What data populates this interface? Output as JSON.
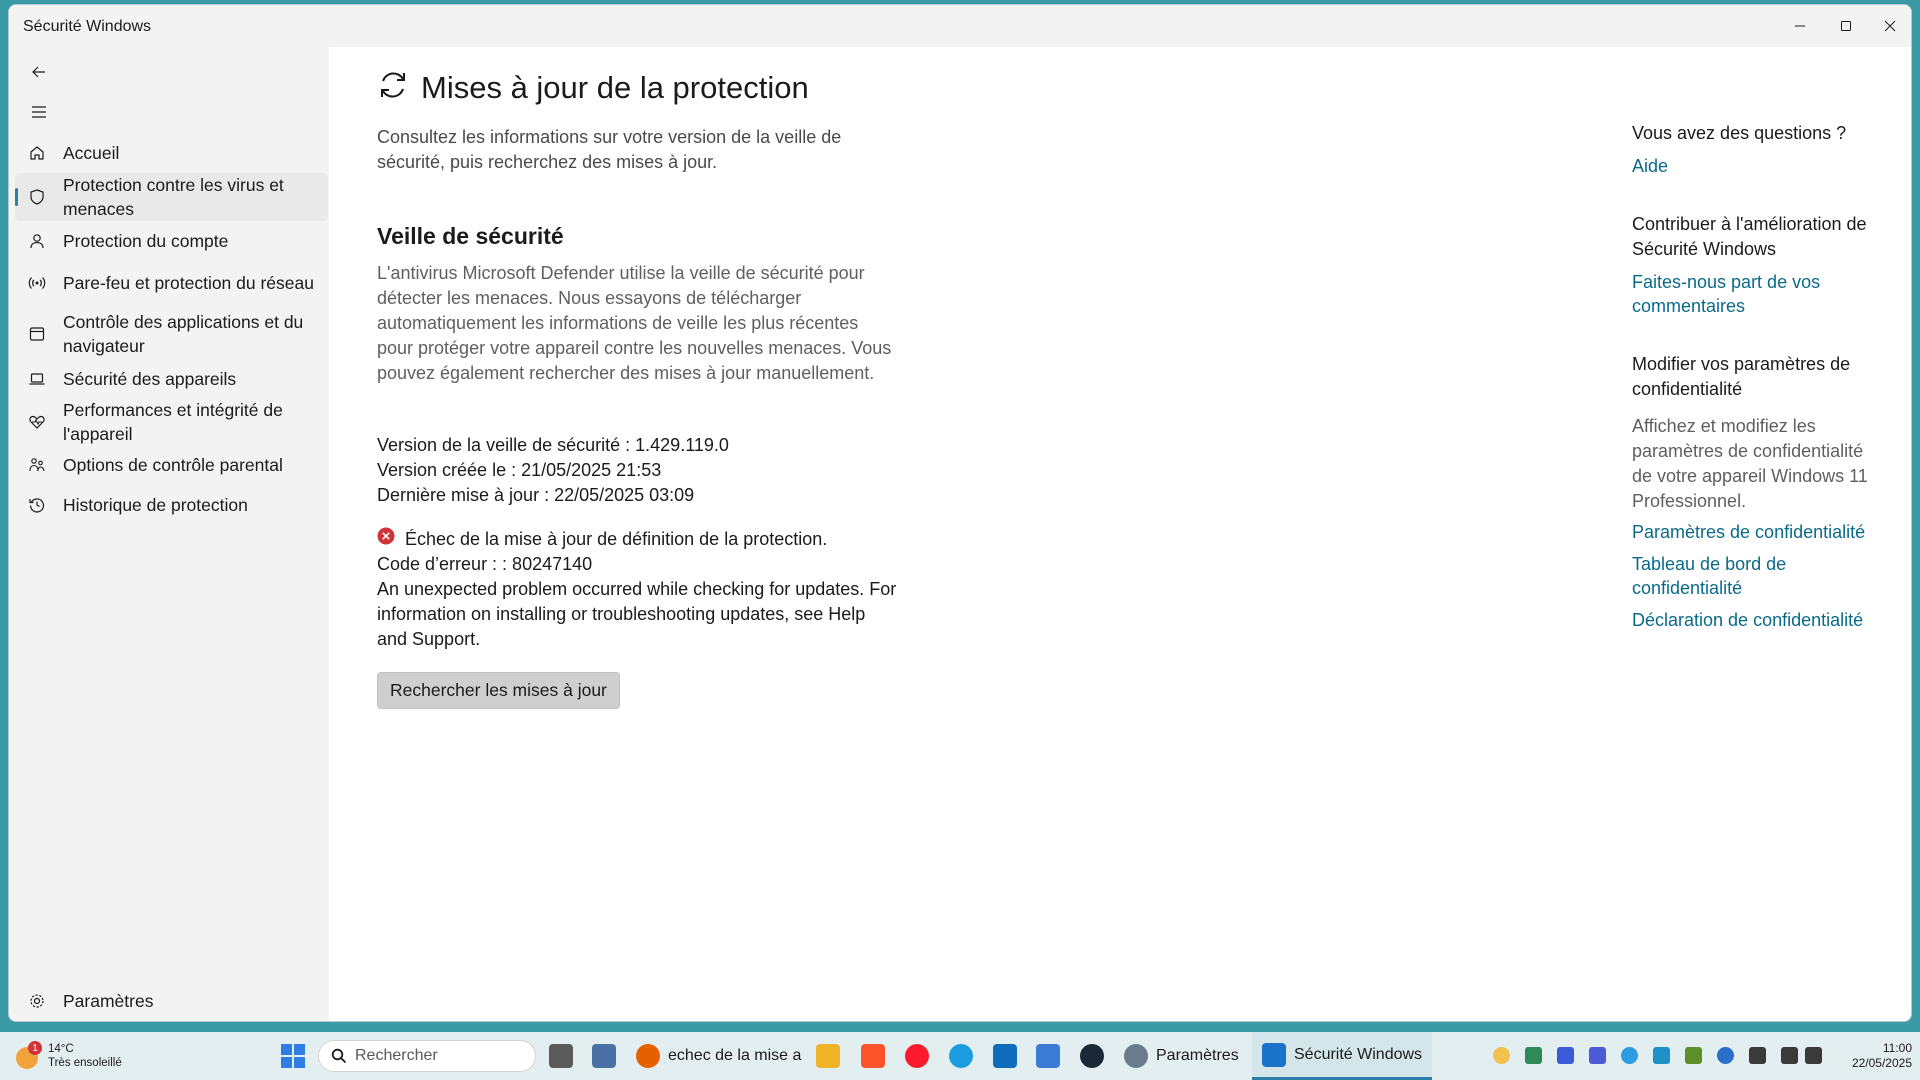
{
  "window": {
    "title": "Sécurité Windows",
    "controls": [
      "minimize",
      "maximize",
      "close"
    ]
  },
  "sidebar": {
    "back_icon": "back-arrow-icon",
    "menu_icon": "hamburger-menu-icon",
    "items": [
      {
        "label": "Accueil",
        "icon": "home-icon",
        "active": false
      },
      {
        "label": "Protection contre les virus et menaces",
        "icon": "shield-icon",
        "active": true
      },
      {
        "label": "Protection du compte",
        "icon": "person-icon",
        "active": false
      },
      {
        "label": "Pare-feu et protection du réseau",
        "icon": "antenna-icon",
        "active": false
      },
      {
        "label": "Contrôle des applications et du navigateur",
        "icon": "app-window-icon",
        "active": false
      },
      {
        "label": "Sécurité des appareils",
        "icon": "laptop-icon",
        "active": false
      },
      {
        "label": "Performances et intégrité de l'appareil",
        "icon": "heart-pulse-icon",
        "active": false
      },
      {
        "label": "Options de contrôle parental",
        "icon": "family-icon",
        "active": false
      },
      {
        "label": "Historique de protection",
        "icon": "history-icon",
        "active": false
      }
    ],
    "settings": {
      "label": "Paramètres",
      "icon": "gear-icon"
    }
  },
  "main": {
    "title": "Mises à jour de la protection",
    "title_icon": "refresh-icon",
    "description": "Consultez les informations sur votre version de la veille de sécurité, puis recherchez des mises à jour.",
    "section_title": "Veille de sécurité",
    "section_text": "L'antivirus Microsoft Defender utilise la veille de sécurité pour détecter les menaces. Nous essayons de télécharger automatiquement les informations de veille les plus récentes pour protéger votre appareil contre les nouvelles menaces. Vous pouvez également rechercher des mises à jour manuellement.",
    "info": {
      "version": "Version de la veille de sécurité : 1.429.119.0",
      "created": "Version créée le : 21/05/2025 21:53",
      "last_update": "Dernière mise à jour : 22/05/2025 03:09"
    },
    "error": {
      "icon": "error-circle-icon",
      "title": "Échec de la mise à jour de définition de la protection.",
      "code": "Code d’erreur : : 80247140",
      "message": "An unexpected problem occurred while checking for updates. For information on installing or troubleshooting updates, see Help and Support."
    },
    "check_button": "Rechercher les mises à jour"
  },
  "right_panel": {
    "questions_heading": "Vous avez des questions ?",
    "help_link": "Aide",
    "contribute_heading": "Contribuer à l'amélioration de Sécurité Windows",
    "feedback_link": "Faites-nous part de vos commentaires",
    "privacy_heading": "Modifier vos paramètres de confidentialité",
    "privacy_text": "Affichez et modifiez les paramètres de confidentialité de votre appareil Windows 11 Professionnel.",
    "privacy_links": [
      "Paramètres de confidentialité",
      "Tableau de bord de confidentialité",
      "Déclaration de confidentialité"
    ]
  },
  "taskbar": {
    "weather_temp": "14°C",
    "weather_desc": "Très ensoleillé",
    "weather_badge": "1",
    "search_placeholder": "Rechercher",
    "apps": [
      {
        "label": "echec de la mise a",
        "icon": "firefox-icon"
      },
      {
        "label": "Paramètres",
        "icon": "settings-app-icon"
      },
      {
        "label": "Sécurité Windows",
        "icon": "windows-security-icon"
      }
    ],
    "time": "11:00",
    "date": "22/05/2025"
  },
  "colors": {
    "accent": "#0a6a8a",
    "active_indicator": "#2b7fa8",
    "error": "#d13438",
    "desktop": "#3a9aa5"
  }
}
